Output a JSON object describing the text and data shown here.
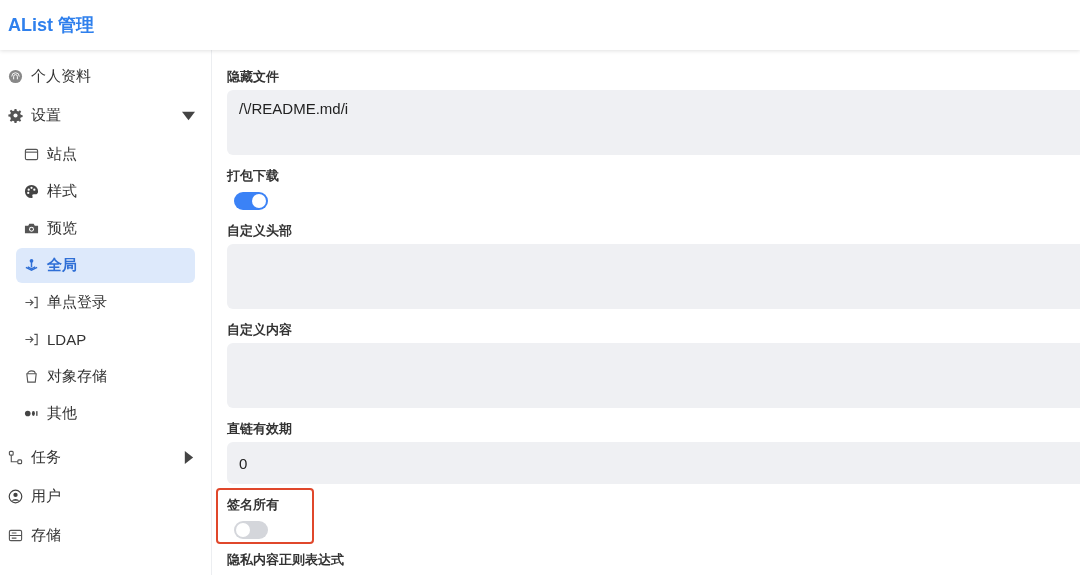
{
  "header": {
    "title": "AList 管理"
  },
  "sidebar": {
    "items": [
      {
        "label": "个人资料",
        "selected": false
      },
      {
        "label": "设置",
        "selected": false,
        "expanded": true,
        "children": [
          {
            "label": "站点",
            "selected": false
          },
          {
            "label": "样式",
            "selected": false
          },
          {
            "label": "预览",
            "selected": false
          },
          {
            "label": "全局",
            "selected": true
          },
          {
            "label": "单点登录",
            "selected": false
          },
          {
            "label": "LDAP",
            "selected": false
          },
          {
            "label": "对象存储",
            "selected": false
          },
          {
            "label": "其他",
            "selected": false
          }
        ]
      },
      {
        "label": "任务",
        "selected": false,
        "expanded": false
      },
      {
        "label": "用户",
        "selected": false
      },
      {
        "label": "存储",
        "selected": false
      }
    ]
  },
  "fields": [
    {
      "label": "隐藏文件",
      "kind": "textarea",
      "value": "/\\/README.md/i"
    },
    {
      "label": "打包下载",
      "kind": "switch",
      "on": true
    },
    {
      "label": "自定义头部",
      "kind": "textarea"
    },
    {
      "label": "自定义内容",
      "kind": "textarea"
    },
    {
      "label": "直链有效期",
      "kind": "input",
      "value": "0"
    },
    {
      "label": "签名所有",
      "kind": "switch",
      "on": false,
      "highlighted": true
    },
    {
      "label": "隐私内容正则表达式",
      "kind": "label"
    }
  ]
}
